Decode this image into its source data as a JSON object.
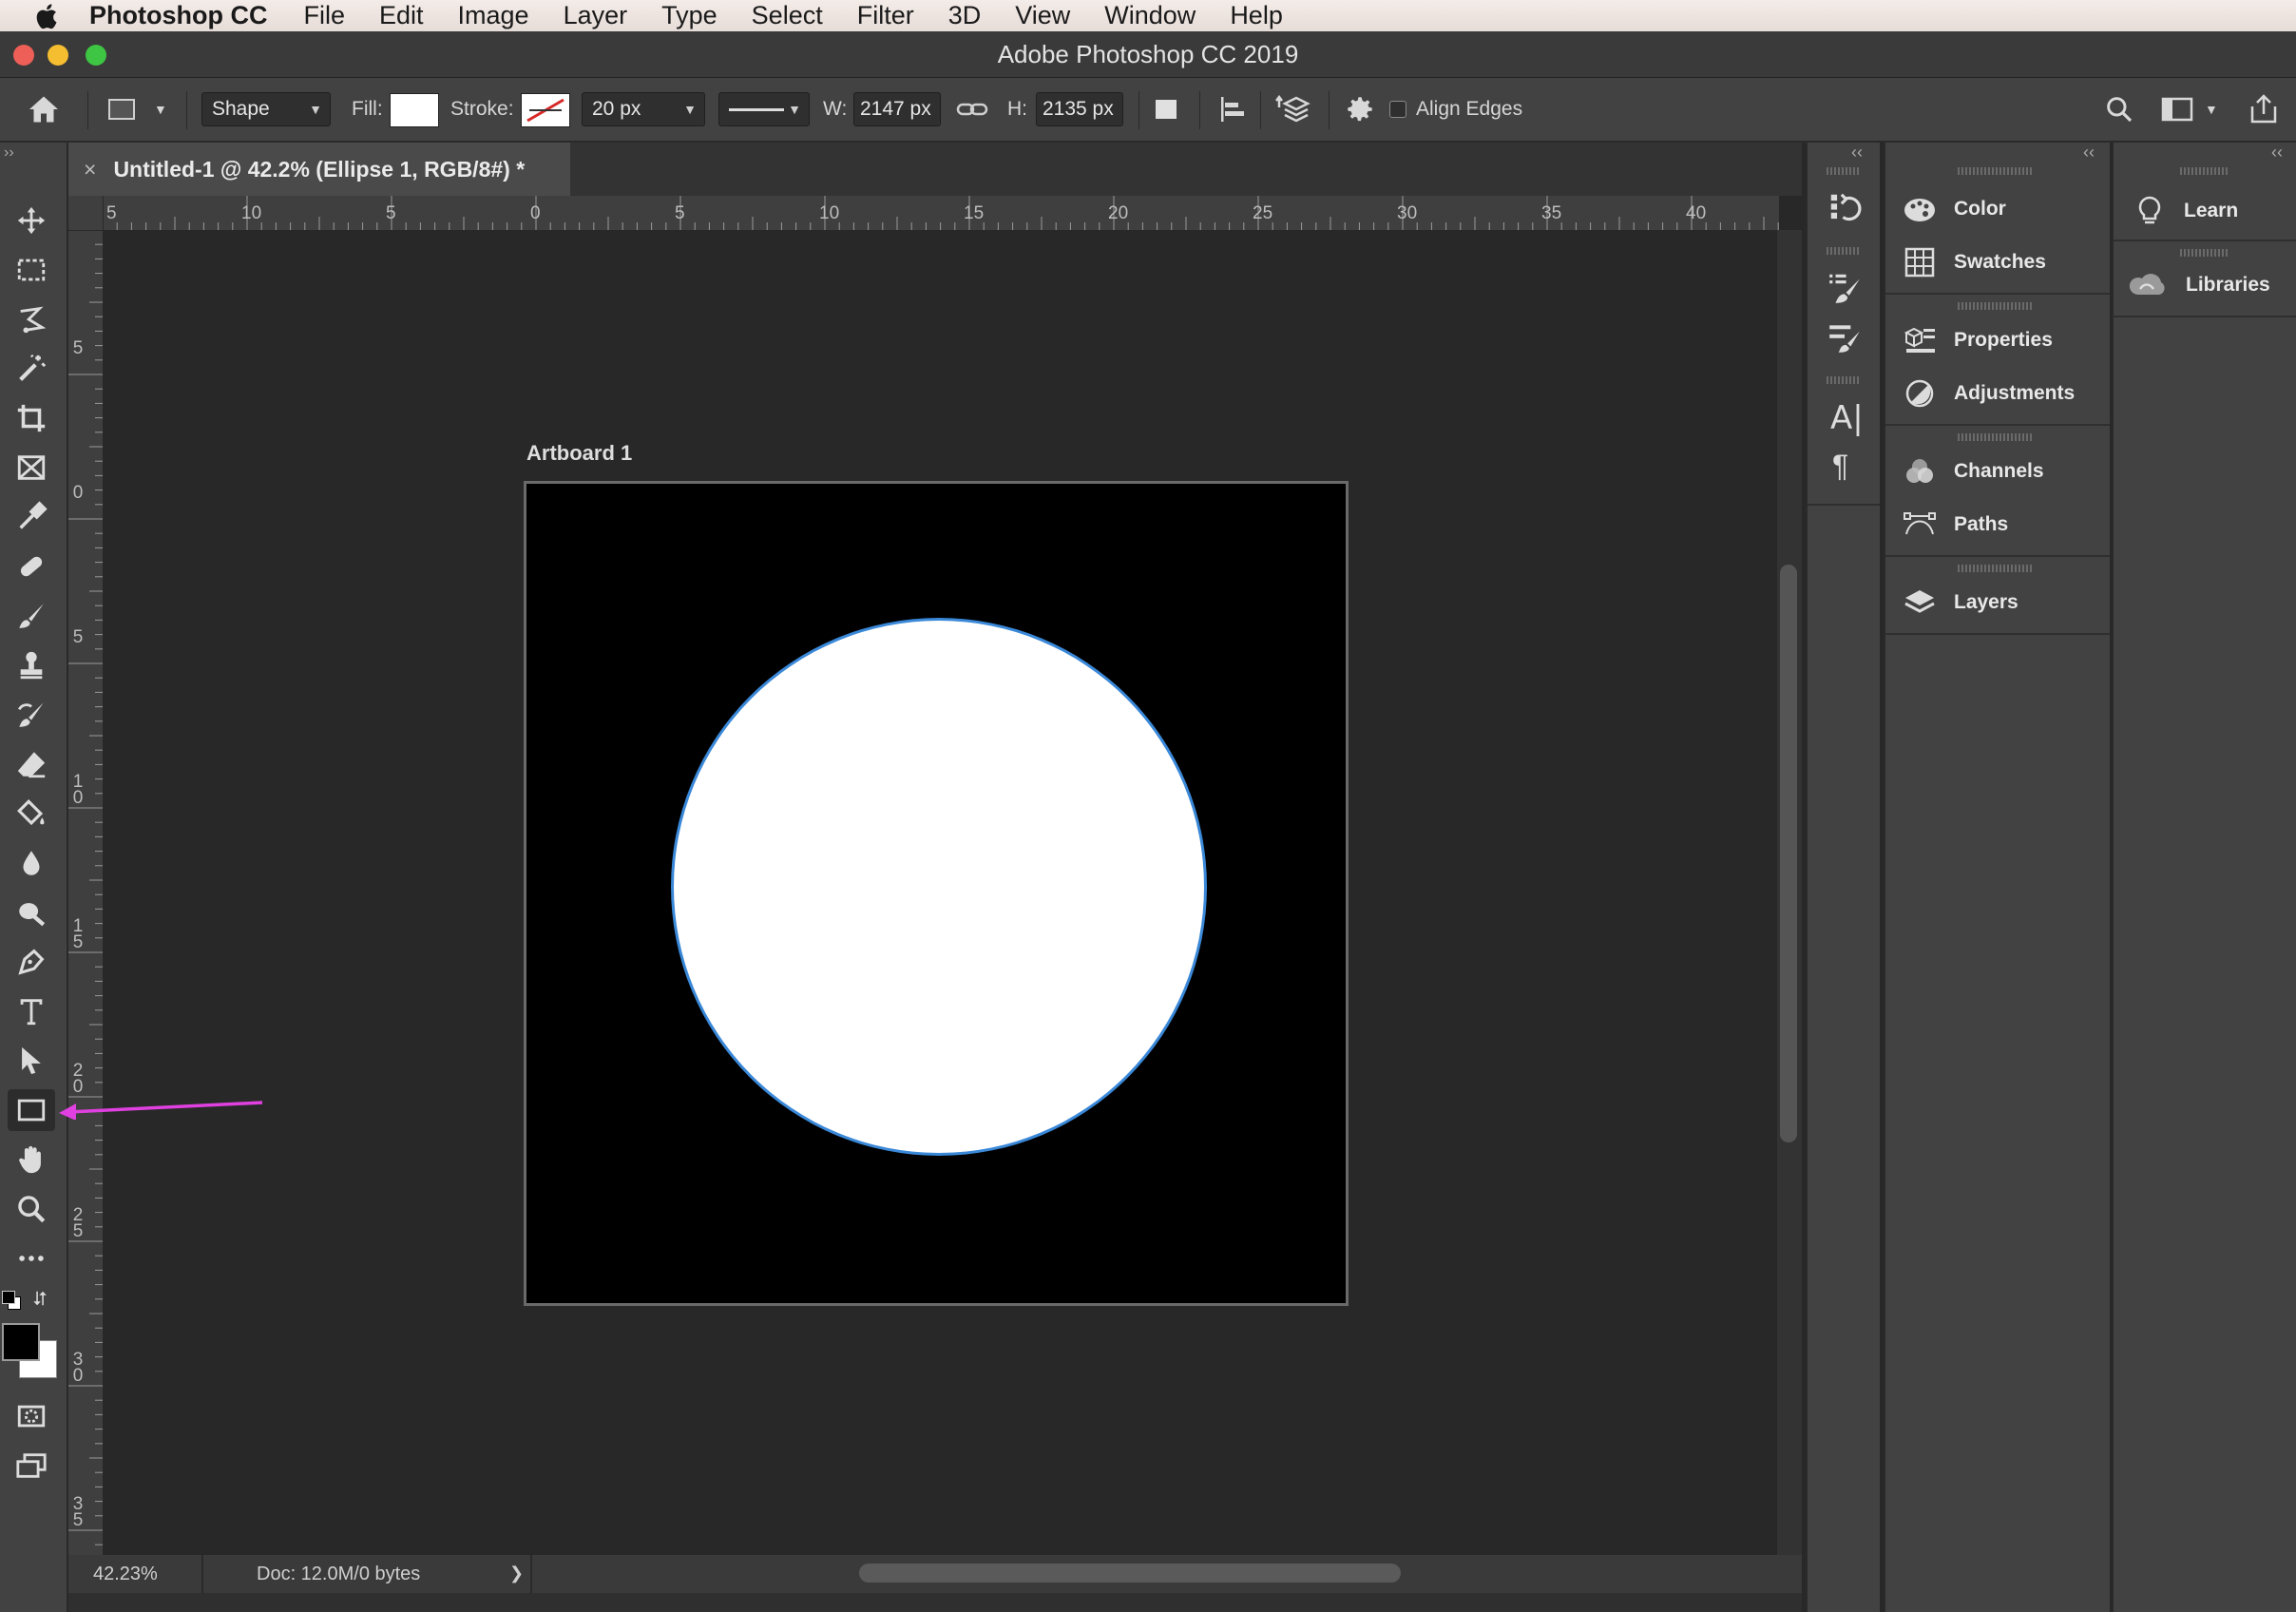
{
  "menubar": {
    "app_name": "Photoshop CC",
    "items": [
      "File",
      "Edit",
      "Image",
      "Layer",
      "Type",
      "Select",
      "Filter",
      "3D",
      "View",
      "Window",
      "Help"
    ]
  },
  "window": {
    "title": "Adobe Photoshop CC 2019"
  },
  "options_bar": {
    "mode_value": "Shape",
    "fill_label": "Fill:",
    "stroke_label": "Stroke:",
    "stroke_width_value": "20 px",
    "width_label": "W:",
    "width_value": "2147 px",
    "height_label": "H:",
    "height_value": "2135 px",
    "align_edges_label": "Align Edges",
    "align_edges_checked": false
  },
  "document": {
    "tab_title": "Untitled-1 @ 42.2% (Ellipse 1, RGB/8#) *",
    "close_glyph": "×",
    "artboard_label": "Artboard 1"
  },
  "ruler": {
    "h_labels": [
      "5",
      "10",
      "5",
      "0",
      "5",
      "10",
      "15",
      "20",
      "25",
      "30",
      "35",
      "40"
    ],
    "v_labels": [
      "5",
      "0",
      "5",
      "10",
      "15",
      "20",
      "25",
      "30",
      "35"
    ]
  },
  "status": {
    "zoom": "42.23%",
    "doc_info": "Doc: 12.0M/0 bytes",
    "arrow_glyph": "❯"
  },
  "panels": {
    "column1": [
      "Color",
      "Swatches",
      "Properties",
      "Adjustments",
      "Channels",
      "Paths",
      "Layers"
    ],
    "column2": [
      "Learn",
      "Libraries"
    ]
  },
  "colors": {
    "foreground": "#000000",
    "background": "#ffffff",
    "annotation_arrow": "#e040e0",
    "ellipse_stroke": "#3a88d8"
  },
  "icons": [
    "apple-icon",
    "home-icon",
    "move-icon",
    "marquee-icon",
    "lasso-icon",
    "magic-wand-icon",
    "crop-icon",
    "frame-icon",
    "eyedropper-icon",
    "healing-icon",
    "brush-icon",
    "stamp-icon",
    "history-brush-icon",
    "eraser-icon",
    "paint-bucket-icon",
    "blur-icon",
    "dodge-icon",
    "pen-icon",
    "type-icon",
    "path-select-icon",
    "rectangle-icon",
    "hand-icon",
    "zoom-icon",
    "more-icon",
    "quick-mask-icon",
    "screen-mode-icon",
    "search-icon",
    "workspace-icon",
    "share-icon",
    "gear-icon",
    "link-icon"
  ]
}
